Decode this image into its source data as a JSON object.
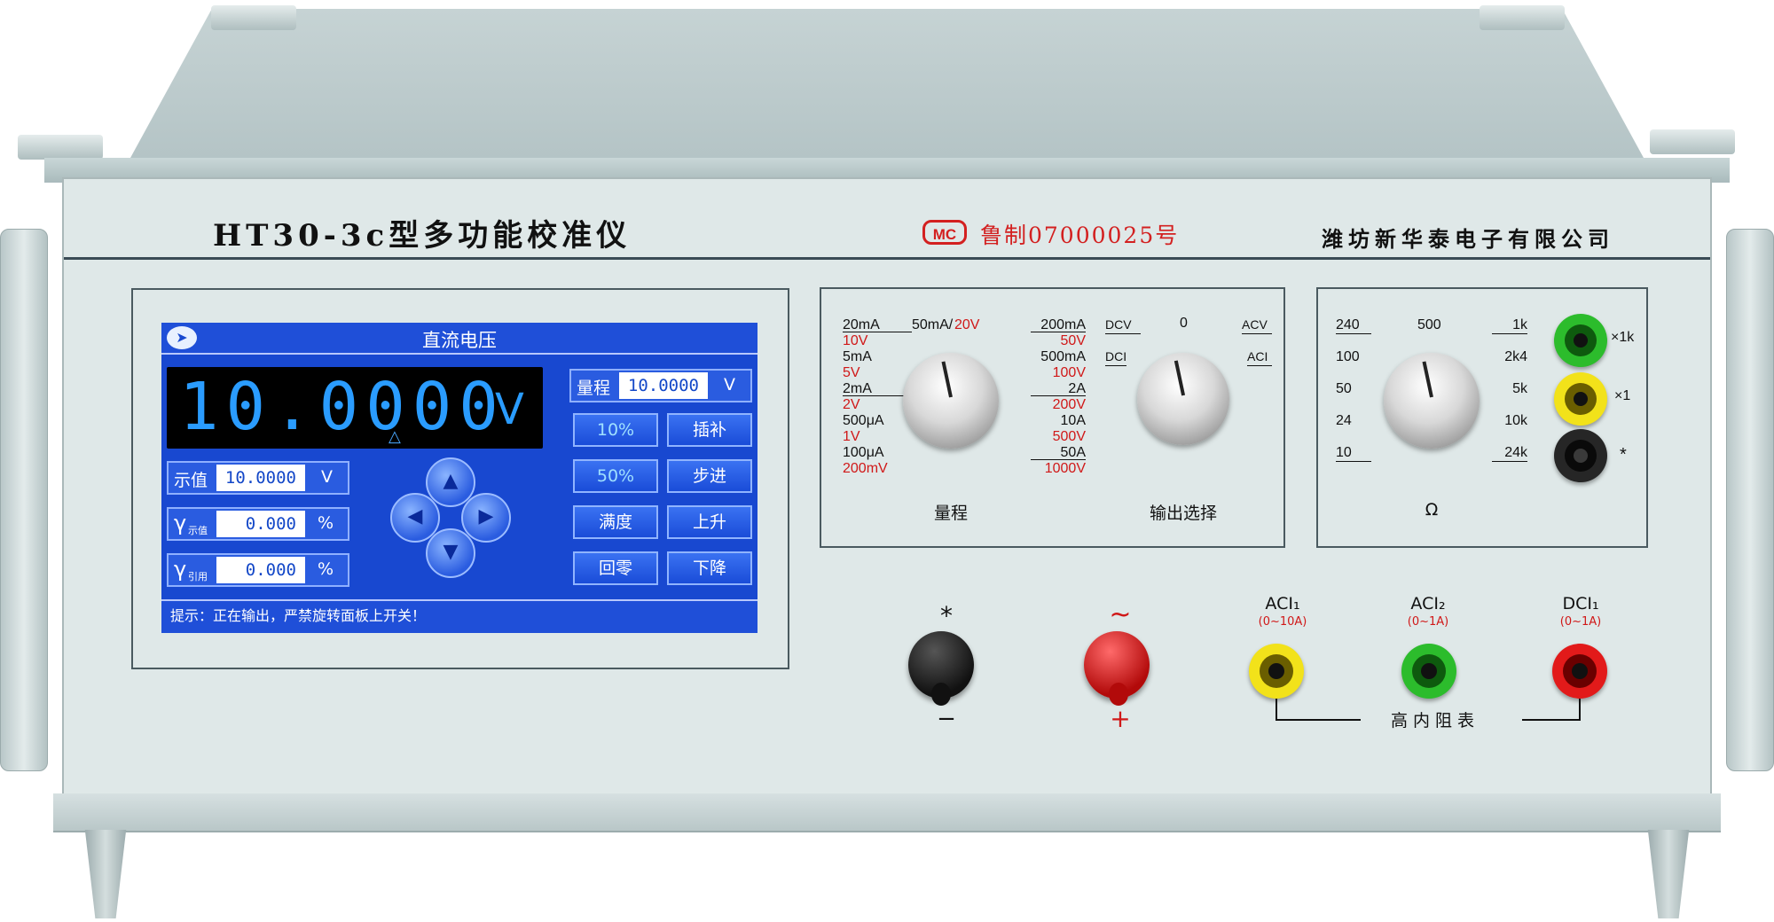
{
  "header": {
    "model_title": "HT30-3c型多功能校准仪",
    "cert_logo": "MC",
    "cert_text": "鲁制07000025号",
    "company": "潍坊新华泰电子有限公司"
  },
  "screen": {
    "title": "直流电压",
    "readout": {
      "value": "10.0000",
      "unit": "V"
    },
    "range": {
      "label": "量程",
      "value": "10.0000",
      "unit": "V"
    },
    "indication": {
      "label": "示值",
      "value": "10.0000",
      "unit": "V"
    },
    "gamma_indication": {
      "label": "γ",
      "sub": "示值",
      "value": "0.000",
      "unit": "%"
    },
    "gamma_reference": {
      "label": "γ",
      "sub": "引用",
      "value": "0.000",
      "unit": "%"
    },
    "buttons": {
      "p10": "10%",
      "interpolate": "插补",
      "p50": "50%",
      "step": "步进",
      "full": "满度",
      "up": "上升",
      "zero": "回零",
      "down": "下降"
    },
    "status": "提示：正在输出，严禁旋转面板上开关！"
  },
  "range_dial": {
    "caption": "量程",
    "left": [
      {
        "a": "20mA",
        "b": "10V"
      },
      {
        "a": "5mA",
        "b": "5V"
      },
      {
        "a": "2mA",
        "b": "2V"
      },
      {
        "a": "500μA",
        "b": "1V"
      },
      {
        "a": "100μA",
        "b": "200mV"
      }
    ],
    "top_a": "50mA/",
    "top_b": "20V",
    "right": [
      {
        "a": "200mA",
        "b": "50V"
      },
      {
        "a": "500mA",
        "b": "100V"
      },
      {
        "a": "2A",
        "b": "200V"
      },
      {
        "a": "10A",
        "b": "500V"
      },
      {
        "a": "50A",
        "b": "1000V"
      }
    ]
  },
  "output_dial": {
    "caption": "输出选择",
    "labels": {
      "dcv": "DCV",
      "zero": "0",
      "acv": "ACV",
      "dci": "DCI",
      "aci": "ACI"
    }
  },
  "ohm_dial": {
    "caption": "Ω",
    "left": [
      "240",
      "100",
      "50",
      "24",
      "10"
    ],
    "top": "500",
    "right": [
      "1k",
      "2k4",
      "5k",
      "10k",
      "24k"
    ],
    "jack_labels": {
      "x1k": "×1k",
      "x1": "×1",
      "star": "*"
    }
  },
  "terminals": {
    "black_post": {
      "top": "*",
      "bottom": "−"
    },
    "red_post": {
      "top": "~",
      "bottom": "+"
    },
    "aci1": {
      "label": "ACI₁",
      "range": "(0~10A)"
    },
    "aci2": {
      "label": "ACI₂",
      "range": "(0~1A)"
    },
    "dci1": {
      "label": "DCI₁",
      "range": "(0~1A)"
    },
    "high_z": "高 内 阻 表"
  },
  "colors": {
    "screen_blue": "#1848d0",
    "readout_blue": "#2a9cff",
    "accent_red": "#d32020",
    "panel": "#dfe8e8"
  }
}
